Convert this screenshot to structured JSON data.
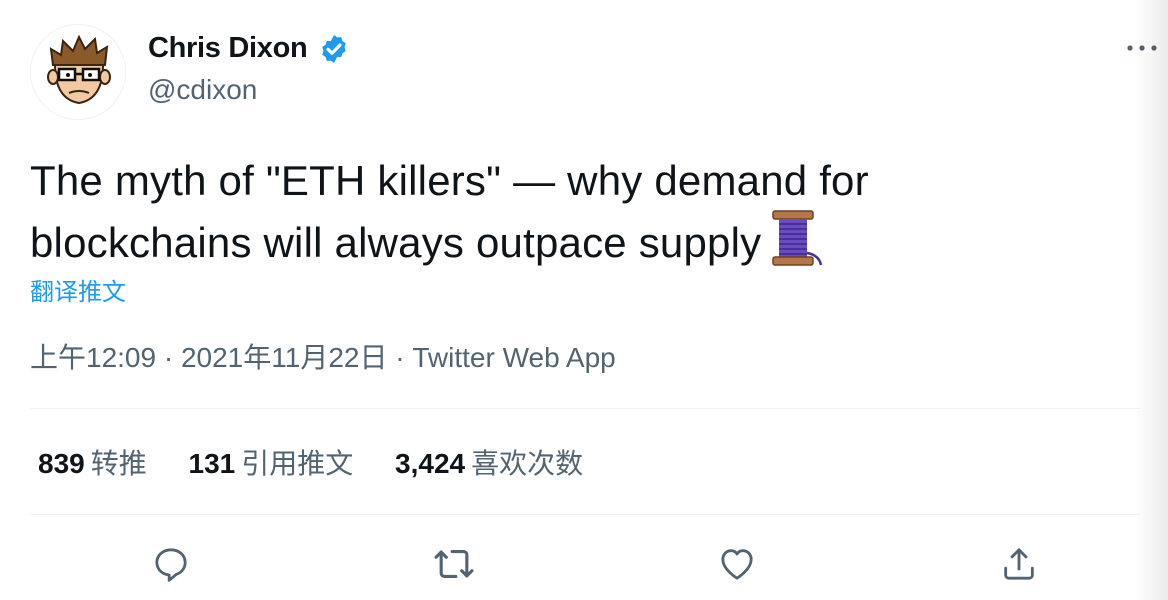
{
  "author": {
    "display_name": "Chris Dixon",
    "handle": "@cdixon",
    "verified": true
  },
  "tweet": {
    "text_line1": "The myth of \"ETH killers\" — why demand for",
    "text_line2": "blockchains will always outpace supply",
    "emoji": "thread-spool-icon",
    "translate_label": "翻译推文",
    "time": "上午12:09",
    "date": "2021年11月22日",
    "separator": " · ",
    "source": "Twitter Web App"
  },
  "stats": {
    "retweets": {
      "count": "839",
      "label": "转推"
    },
    "quotes": {
      "count": "131",
      "label": "引用推文"
    },
    "likes": {
      "count": "3,424",
      "label": "喜欢次数"
    }
  },
  "actions": [
    "reply-icon",
    "retweet-icon",
    "like-icon",
    "share-icon"
  ],
  "colors": {
    "text_primary": "#0f1419",
    "text_secondary": "#536471",
    "accent": "#1d9bf0",
    "divider": "#eff3f4",
    "verified_badge": "#1d9bf0"
  }
}
